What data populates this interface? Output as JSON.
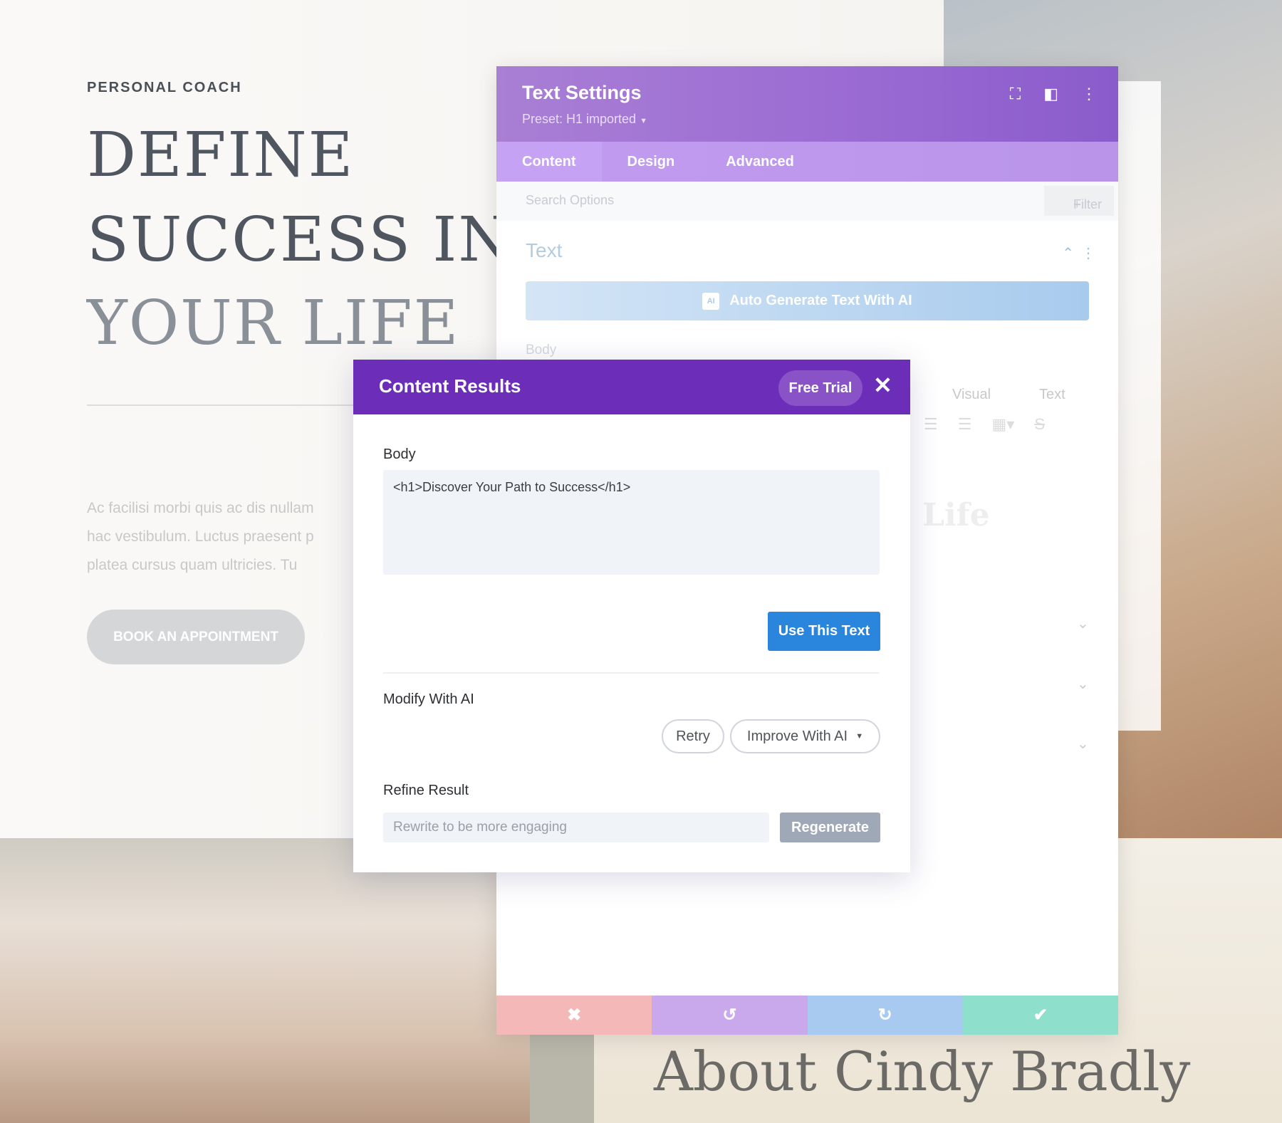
{
  "page": {
    "eyebrow": "PERSONAL COACH",
    "heading_lines": [
      "DEFINE",
      "SUCCESS IN",
      "YOUR LIFE"
    ],
    "paragraph_lines": [
      "Ac facilisi morbi quis ac dis nullam",
      "hac vestibulum. Luctus praesent p",
      "platea cursus quam ultricies. Tu"
    ],
    "cta": "BOOK AN APPOINTMENT",
    "about_title": "About Cindy Bradly",
    "preview_word": "Life"
  },
  "settings": {
    "title": "Text Settings",
    "preset": "Preset: H1 imported",
    "tabs": [
      "Content",
      "Design",
      "Advanced"
    ],
    "active_tab": "Content",
    "search_placeholder": "Search Options",
    "filter_label": "Filter",
    "group_title": "Text",
    "ai_button": "Auto Generate Text With AI",
    "ai_badge": "AI",
    "body_label": "Body",
    "editor_tabs": [
      "Visual",
      "Text"
    ],
    "footer_colors": [
      "#f5b8b8",
      "#c9a8ec",
      "#a8caf0",
      "#8ee0cc"
    ]
  },
  "modal": {
    "title": "Content Results",
    "free_trial": "Free Trial",
    "body_label": "Body",
    "body_value": "<h1>Discover Your Path to Success</h1>",
    "use_button": "Use This Text",
    "modify_label": "Modify With AI",
    "retry": "Retry",
    "improve": "Improve With AI",
    "refine_label": "Refine Result",
    "refine_placeholder": "Rewrite to be more engaging",
    "regenerate": "Regenerate",
    "header_color": "#6c2eb9",
    "accent": "#2a86dc"
  }
}
